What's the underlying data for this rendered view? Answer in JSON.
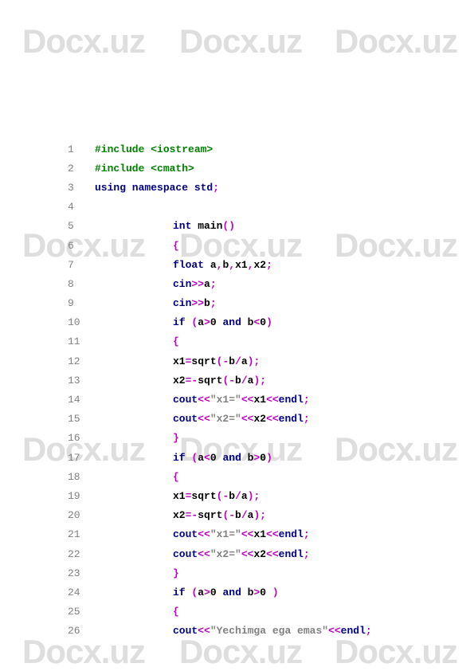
{
  "watermark": "Docx.uz",
  "code": {
    "lines": [
      {
        "n": "1",
        "tokens": [
          [
            "green",
            "#include <iostream>"
          ]
        ]
      },
      {
        "n": "2",
        "tokens": [
          [
            "green",
            "#include <cmath>"
          ]
        ]
      },
      {
        "n": "3",
        "tokens": [
          [
            "navy",
            "using namespace std"
          ],
          [
            "magenta",
            ";"
          ]
        ]
      },
      {
        "n": "4",
        "tokens": []
      },
      {
        "n": "5",
        "indent": true,
        "tokens": [
          [
            "navy",
            "int"
          ],
          [
            "black",
            " main"
          ],
          [
            "magenta",
            "()"
          ]
        ]
      },
      {
        "n": "6",
        "indent": true,
        "tokens": [
          [
            "magenta",
            "{"
          ]
        ]
      },
      {
        "n": "7",
        "indent": true,
        "tokens": [
          [
            "navy",
            "float"
          ],
          [
            "black",
            " a"
          ],
          [
            "magenta",
            ","
          ],
          [
            "black",
            "b"
          ],
          [
            "magenta",
            ","
          ],
          [
            "black",
            "x1"
          ],
          [
            "magenta",
            ","
          ],
          [
            "black",
            "x2"
          ],
          [
            "magenta",
            ";"
          ]
        ]
      },
      {
        "n": "8",
        "indent": true,
        "tokens": [
          [
            "navy",
            "cin"
          ],
          [
            "magenta",
            ">>"
          ],
          [
            "black",
            "a"
          ],
          [
            "magenta",
            ";"
          ]
        ]
      },
      {
        "n": "9",
        "indent": true,
        "tokens": [
          [
            "navy",
            "cin"
          ],
          [
            "magenta",
            ">>"
          ],
          [
            "black",
            "b"
          ],
          [
            "magenta",
            ";"
          ]
        ]
      },
      {
        "n": "10",
        "indent": true,
        "tokens": [
          [
            "navy",
            "if"
          ],
          [
            "black",
            " "
          ],
          [
            "magenta",
            "("
          ],
          [
            "black",
            "a"
          ],
          [
            "magenta",
            ">"
          ],
          [
            "black",
            "0 "
          ],
          [
            "navy",
            "and"
          ],
          [
            "black",
            " b"
          ],
          [
            "magenta",
            "<"
          ],
          [
            "black",
            "0"
          ],
          [
            "magenta",
            ")"
          ]
        ]
      },
      {
        "n": "11",
        "indent": true,
        "tokens": [
          [
            "magenta",
            "{"
          ]
        ]
      },
      {
        "n": "12",
        "indent": true,
        "tokens": [
          [
            "black",
            "x1"
          ],
          [
            "magenta",
            "="
          ],
          [
            "black",
            "sqrt"
          ],
          [
            "magenta",
            "(-"
          ],
          [
            "black",
            "b"
          ],
          [
            "magenta",
            "/"
          ],
          [
            "black",
            "a"
          ],
          [
            "magenta",
            ");"
          ]
        ]
      },
      {
        "n": "13",
        "indent": true,
        "tokens": [
          [
            "black",
            "x2"
          ],
          [
            "magenta",
            "=-"
          ],
          [
            "black",
            "sqrt"
          ],
          [
            "magenta",
            "(-"
          ],
          [
            "black",
            "b"
          ],
          [
            "magenta",
            "/"
          ],
          [
            "black",
            "a"
          ],
          [
            "magenta",
            ");"
          ]
        ]
      },
      {
        "n": "14",
        "indent": true,
        "tokens": [
          [
            "navy",
            "cout"
          ],
          [
            "magenta",
            "<<"
          ],
          [
            "gray",
            "\"x1=\""
          ],
          [
            "magenta",
            "<<"
          ],
          [
            "black",
            "x1"
          ],
          [
            "magenta",
            "<<"
          ],
          [
            "navy",
            "endl"
          ],
          [
            "magenta",
            ";"
          ]
        ]
      },
      {
        "n": "15",
        "indent": true,
        "tokens": [
          [
            "navy",
            "cout"
          ],
          [
            "magenta",
            "<<"
          ],
          [
            "gray",
            "\"x2=\""
          ],
          [
            "magenta",
            "<<"
          ],
          [
            "black",
            "x2"
          ],
          [
            "magenta",
            "<<"
          ],
          [
            "navy",
            "endl"
          ],
          [
            "magenta",
            ";"
          ]
        ]
      },
      {
        "n": "16",
        "indent": true,
        "tokens": [
          [
            "magenta",
            "}"
          ]
        ]
      },
      {
        "n": "17",
        "indent": true,
        "tokens": [
          [
            "navy",
            "if"
          ],
          [
            "black",
            " "
          ],
          [
            "magenta",
            "("
          ],
          [
            "black",
            "a"
          ],
          [
            "magenta",
            "<"
          ],
          [
            "black",
            "0 "
          ],
          [
            "navy",
            "and"
          ],
          [
            "black",
            " b"
          ],
          [
            "magenta",
            ">"
          ],
          [
            "black",
            "0"
          ],
          [
            "magenta",
            ")"
          ]
        ]
      },
      {
        "n": "18",
        "indent": true,
        "tokens": [
          [
            "magenta",
            "{"
          ]
        ]
      },
      {
        "n": "19",
        "indent": true,
        "tokens": [
          [
            "black",
            "x1"
          ],
          [
            "magenta",
            "="
          ],
          [
            "black",
            "sqrt"
          ],
          [
            "magenta",
            "(-"
          ],
          [
            "black",
            "b"
          ],
          [
            "magenta",
            "/"
          ],
          [
            "black",
            "a"
          ],
          [
            "magenta",
            ");"
          ]
        ]
      },
      {
        "n": "20",
        "indent": true,
        "tokens": [
          [
            "black",
            "x2"
          ],
          [
            "magenta",
            "=-"
          ],
          [
            "black",
            "sqrt"
          ],
          [
            "magenta",
            "(-"
          ],
          [
            "black",
            "b"
          ],
          [
            "magenta",
            "/"
          ],
          [
            "black",
            "a"
          ],
          [
            "magenta",
            ");"
          ]
        ]
      },
      {
        "n": "21",
        "indent": true,
        "tokens": [
          [
            "navy",
            "cout"
          ],
          [
            "magenta",
            "<<"
          ],
          [
            "gray",
            "\"x1=\""
          ],
          [
            "magenta",
            "<<"
          ],
          [
            "black",
            "x1"
          ],
          [
            "magenta",
            "<<"
          ],
          [
            "navy",
            "endl"
          ],
          [
            "magenta",
            ";"
          ]
        ]
      },
      {
        "n": "22",
        "indent": true,
        "tokens": [
          [
            "navy",
            "cout"
          ],
          [
            "magenta",
            "<<"
          ],
          [
            "gray",
            "\"x2=\""
          ],
          [
            "magenta",
            "<<"
          ],
          [
            "black",
            "x2"
          ],
          [
            "magenta",
            "<<"
          ],
          [
            "navy",
            "endl"
          ],
          [
            "magenta",
            ";"
          ]
        ]
      },
      {
        "n": "23",
        "indent": true,
        "tokens": [
          [
            "magenta",
            "}"
          ]
        ]
      },
      {
        "n": "24",
        "indent": true,
        "tokens": [
          [
            "navy",
            "if"
          ],
          [
            "black",
            " "
          ],
          [
            "magenta",
            "("
          ],
          [
            "black",
            "a"
          ],
          [
            "magenta",
            ">"
          ],
          [
            "black",
            "0 "
          ],
          [
            "navy",
            "and"
          ],
          [
            "black",
            " b"
          ],
          [
            "magenta",
            ">"
          ],
          [
            "black",
            "0 "
          ],
          [
            "magenta",
            ")"
          ]
        ]
      },
      {
        "n": "25",
        "indent": true,
        "tokens": [
          [
            "magenta",
            "{"
          ]
        ]
      },
      {
        "n": "26",
        "indent": true,
        "tokens": [
          [
            "navy",
            "cout"
          ],
          [
            "magenta",
            "<<"
          ],
          [
            "gray",
            "\"Yechimga ega emas\""
          ],
          [
            "magenta",
            "<<"
          ],
          [
            "navy",
            "endl"
          ],
          [
            "magenta",
            ";"
          ]
        ]
      }
    ]
  }
}
